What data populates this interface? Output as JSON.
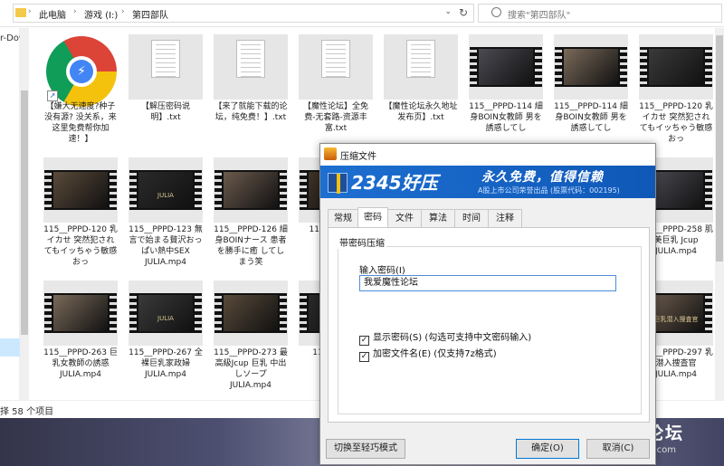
{
  "address": {
    "crumbs": [
      "此电脑",
      "游戏 (I:)",
      "第四部队"
    ],
    "search_placeholder": "搜索\"第四部队\""
  },
  "sidebar": {
    "partial_label": "r-Dow"
  },
  "status": {
    "text": "择 58 个项目"
  },
  "files": [
    {
      "type": "chrome",
      "label": "【嫌大无速度?种子没有源? 没关系，来这里免费帮你加速！】"
    },
    {
      "type": "doc",
      "label": "【解压密码说明】.txt"
    },
    {
      "type": "doc",
      "label": "【来了就能下载的论坛，纯免费！】.txt"
    },
    {
      "type": "doc",
      "label": "【魔性论坛】全免费-无套路-资源丰富.txt"
    },
    {
      "type": "doc",
      "label": "【魔性论坛永久地址发布页】.txt"
    },
    {
      "type": "video",
      "label": "115__PPPD-114 細身BOIN女教師 男を誘惑してし",
      "cap": ""
    },
    {
      "type": "video",
      "label": "115__PPPD-114 細身BOIN女教師 男を誘惑してし",
      "cap": ""
    },
    {
      "type": "video",
      "label": "115__PPPD-120 乳イカせ 突然犯されてもイッちゃう敏感おっ",
      "cap": ""
    },
    {
      "type": "video",
      "label": "115__PPPD-120 乳イカせ 突然犯されてもイッちゃう敏感おっ",
      "cap": ""
    },
    {
      "type": "video",
      "label": "115__PPPD-123 無言で始まる贅沢おっぱい熱中SEX JULIA.mp4",
      "cap": "JULIA"
    },
    {
      "type": "video",
      "label": "115__PPPD-126 細身BOINナース 患者を勝手に癒 してしまう笑",
      "cap": ""
    },
    {
      "type": "video",
      "label": "115__ 癒し れ",
      "cap": ""
    },
    {
      "type": "video",
      "label": "115__PPPD-258 肌美巨乳 Jcup JULIA.mp4",
      "cap": ""
    },
    {
      "type": "video",
      "label": "115__PPPD-263 巨乳女教師の誘惑 JULIA.mp4",
      "cap": ""
    },
    {
      "type": "video",
      "label": "115__PPPD-267 全裸巨乳家政婦 JULIA.mp4",
      "cap": "JULIA"
    },
    {
      "type": "video",
      "label": "115__PPPD-273 最高級Jcup 巨乳 中出しソープ JULIA.mp4",
      "cap": ""
    },
    {
      "type": "video",
      "label": "115__ 巨 ch",
      "cap": ""
    },
    {
      "type": "video",
      "label": "115__PPPD-297 乳潜入捜査官 JULIA.mp4",
      "cap": "巨乳潜入捜査官"
    }
  ],
  "dialog": {
    "title": "压缩文件",
    "brand": "2345好压",
    "slogan": "永久免费，值得信赖",
    "subtext": "A股上市公司荣誉出品 (股票代码：002195)",
    "tabs": [
      "常规",
      "密码",
      "文件",
      "算法",
      "时间",
      "注释"
    ],
    "active_tab": 1,
    "group_title": "带密码压缩",
    "pw_label": "输入密码(I)",
    "pw_value": "我爱魔性论坛",
    "show_pw": "显示密码(S)  (勾选可支持中文密码输入)",
    "encrypt_names": "加密文件名(E)  (仅支持7z格式)",
    "switch_btn": "切换至轻巧模式",
    "ok_btn": "确定(O)",
    "cancel_btn": "取消(C)"
  },
  "watermark": {
    "logo": "M",
    "name": "魔性论坛",
    "url": "moxinbbs.com"
  }
}
